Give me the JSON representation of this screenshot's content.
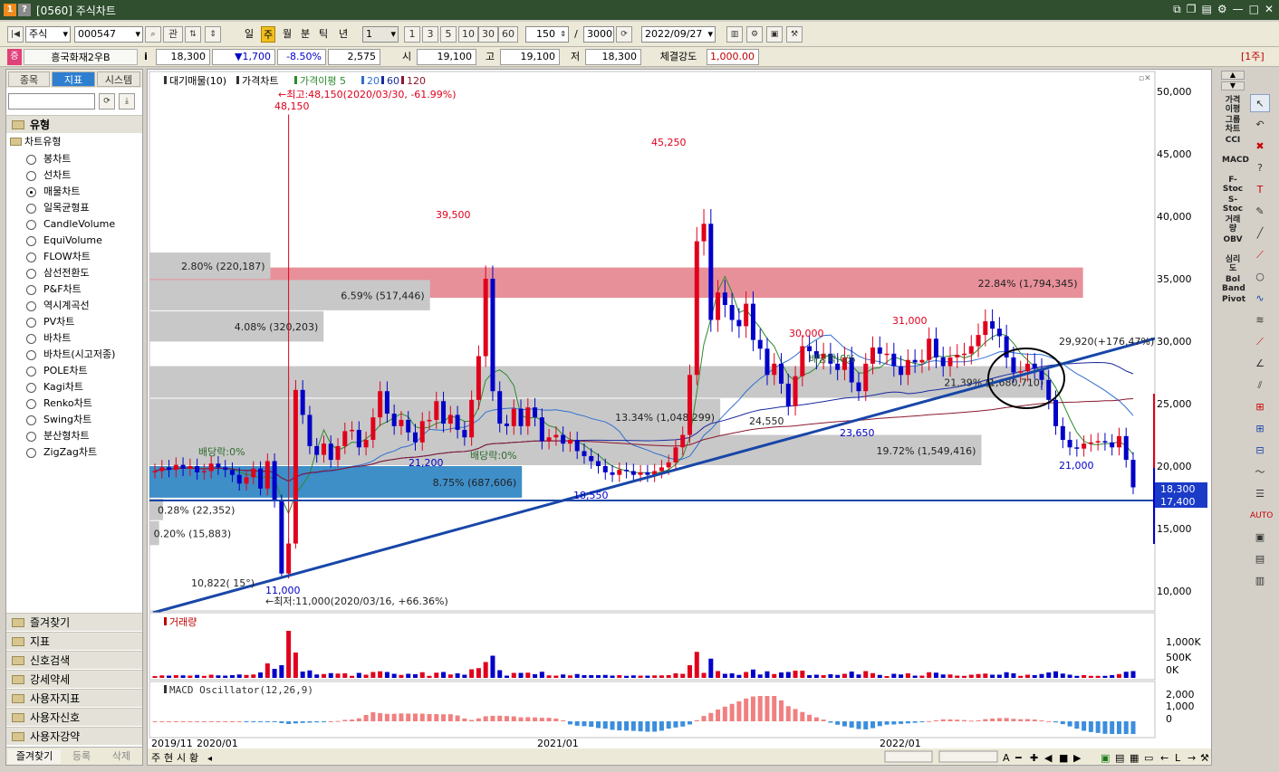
{
  "window": {
    "title": "[0560] 주식차트",
    "icon1": "1",
    "icon2": "?"
  },
  "toolbar": {
    "market": "주식",
    "code": "000547",
    "btn_gwan": "관",
    "periods": [
      "일",
      "주",
      "월",
      "분",
      "틱",
      "년"
    ],
    "interval": "1",
    "interval_presets": [
      "1",
      "3",
      "5",
      "10",
      "30",
      "60"
    ],
    "count": "150",
    "slash": "/",
    "total": "3000",
    "date": "2022/09/27"
  },
  "infobar": {
    "badge": "증",
    "name": "흥국화재2우B",
    "info": "i",
    "price": "18,300",
    "change": "▼1,700",
    "change_pct": "-8.50%",
    "volume": "2,575",
    "open_label": "시",
    "open": "19,100",
    "high_label": "고",
    "high": "19,100",
    "low_label": "저",
    "low": "18,300",
    "strength_label": "체결강도",
    "strength": "1,000.00",
    "period_tag": "[1주]"
  },
  "left": {
    "tabs": [
      "종목",
      "지표",
      "시스템"
    ],
    "group_title": "유형",
    "tree_root": "차트유형",
    "chart_types": [
      "봉차트",
      "선차트",
      "매물차트",
      "일목균형표",
      "CandleVolume",
      "EquiVolume",
      "FLOW차트",
      "삼선전환도",
      "P&F차트",
      "역시계곡선",
      "PV차트",
      "바차트",
      "바차트(시고저종)",
      "POLE차트",
      "Kagi차트",
      "Renko차트",
      "Swing차트",
      "분산형차트",
      "ZigZag차트"
    ],
    "selected_index": 2,
    "folders": [
      "즐겨찾기",
      "지표",
      "신호검색",
      "강세약세",
      "사용자지표",
      "사용자신호",
      "사용자강약"
    ],
    "bottom_tabs": [
      "즐겨찾기",
      "등록",
      "삭제"
    ]
  },
  "chart": {
    "legend": {
      "prefix1": "대기매물(10)",
      "prefix2": "가격차트",
      "ma_label": "가격이평 5",
      "ma20": "20",
      "ma60": "60",
      "ma120": "120"
    },
    "hi_note": "←최고:48,150(2020/03/30, -61.99%)",
    "lo_note": "←최저:11,000(2020/03/16, +66.36%)",
    "peak_labels": [
      "48,150",
      "39,500",
      "45,250",
      "30,000",
      "31,000",
      "24,550",
      "23,650",
      "21,200",
      "21,000",
      "18,550",
      "11,000"
    ],
    "dividend_labels": [
      "배당락:0%",
      "배당락:0%",
      "배당락:0%"
    ],
    "volume_profile": [
      {
        "label": "22.84% (1,794,345)",
        "frac": 0.965
      },
      {
        "label": "2.80% (220,187)",
        "frac": 0.125
      },
      {
        "label": "6.59% (517,446)",
        "frac": 0.29
      },
      {
        "label": "4.08% (320,203)",
        "frac": 0.18
      },
      {
        "label": "21.39% (1,680,710)",
        "frac": 0.93
      },
      {
        "label": "13.34% (1,048,299)",
        "frac": 0.59
      },
      {
        "label": "19.72% (1,549,416)",
        "frac": 0.86
      },
      {
        "label": "8.75% (687,606)",
        "frac": 0.385
      },
      {
        "label": "0.28% (22,352)",
        "frac": 0.014
      },
      {
        "label": "0.20% (15,883)",
        "frac": 0.01
      }
    ],
    "trend_note": "29,920(+176.47%)",
    "angle_note": "10,822( 15°)",
    "price_axis": [
      "50,000",
      "45,000",
      "40,000",
      "35,000",
      "30,000",
      "25,000",
      "20,000",
      "15,000",
      "10,000"
    ],
    "current_price": "18,300",
    "hline_price": "17,400",
    "volume_title": "거래량",
    "volume_axis": [
      "1,000K",
      "500K",
      "0K"
    ],
    "macd_title": "MACD Oscillator(12,26,9)",
    "macd_axis": [
      "2,000",
      "1,000",
      "0"
    ],
    "date_axis": [
      "2019/11",
      "2020/01",
      "2021/01",
      "2022/01"
    ],
    "bottom_tabs": [
      "주",
      "현",
      "시",
      "황"
    ]
  },
  "side_labels": [
    "가격이평",
    "그룹차트",
    "CCI",
    "MACD",
    "F-Stoc",
    "S-Stoc",
    "거래량",
    "OBV",
    "심리도",
    "Bol Band",
    "Pivot"
  ],
  "colors": {
    "up": "#e0001c",
    "down": "#0000c8",
    "ma5": "#2c8a2c",
    "ma20": "#2f6fd0",
    "ma60": "#1a2aa0",
    "ma120": "#8a1830",
    "profile_peak": "#e8909a",
    "profile": "#c8c8c8",
    "profile_current": "#3e8ec8",
    "trend": "#1846a8"
  }
}
